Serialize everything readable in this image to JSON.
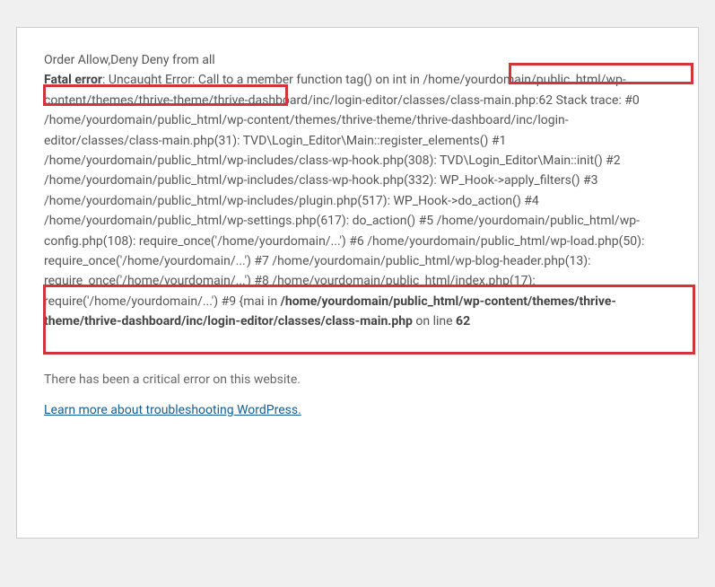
{
  "error": {
    "order_line": "Order Allow,Deny Deny from all",
    "fatal_label": "Fatal error",
    "fatal_colon": ": Uncaught Error: Call to a member function tag() on int in /home/yourdomain/public_html/wp-content/themes/thrive-theme/thrive-dashboard/inc/login-editor/classes/class-main.php:62 Stack trace: #0 /home/yourdomain/public_html/wp-content/themes/thrive-theme/thrive-dashboard/inc/login-editor/classes/class-main.php(31): TVD\\Login_Editor\\Main::register_elements() #1 /home/yourdomain/public_html/wp-includes/class-wp-hook.php(308): TVD\\Login_Editor\\Main::init() #2 /home/yourdomain/public_html/wp-includes/class-wp-hook.php(332): WP_Hook->apply_filters() #3 /home/yourdomain/public_html/wp-includes/plugin.php(517): WP_Hook->do_action() #4 /home/yourdomain/public_html/wp-settings.php(617): do_action() #5 /home/yourdomain/public_html/wp-config.php(108): require_once('/home/yourdomain/...') #6 /home/yourdomain/public_html/wp-load.php(50): require_once('/home/yourdomain/...') #7 /home/yourdomain/public_html/wp-blog-header.php(13): require_once('/home/yourdomain/...') #8 /home/yourdomain/public_html/index.php(17): require('/home/yourdomain/...') #9 {mai in ",
    "bold_path": "/home/yourdomain/public_html/wp-content/themes/thrive-theme/thrive-dashboard/inc/login-editor/classes/class-main.php",
    "on_line": " on line ",
    "line_number": "62"
  },
  "critical_error_text": "There has been a critical error on this website.",
  "link_text": "Learn more about troubleshooting WordPress."
}
